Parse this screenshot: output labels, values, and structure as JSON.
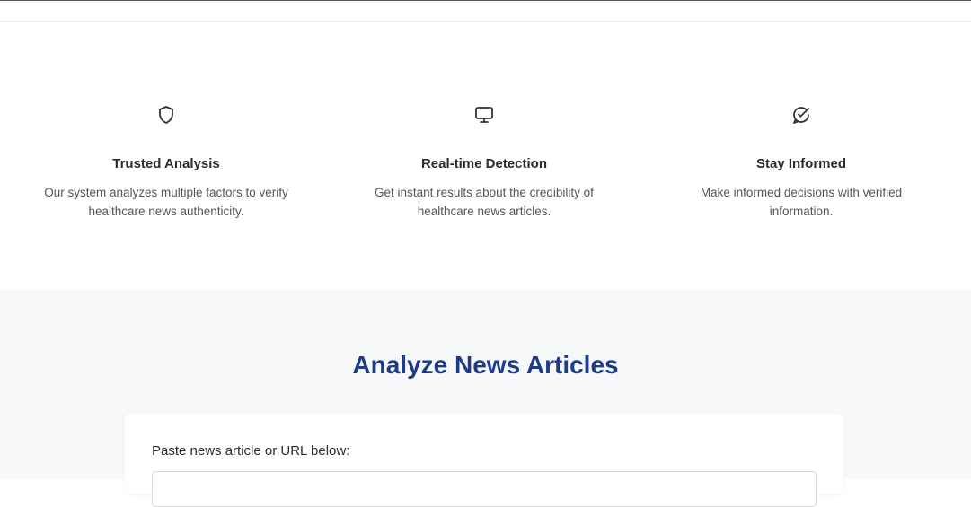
{
  "features": [
    {
      "icon": "shield-icon",
      "title": "Trusted Analysis",
      "description": "Our system analyzes multiple factors to verify healthcare news authenticity."
    },
    {
      "icon": "monitor-icon",
      "title": "Real-time Detection",
      "description": "Get instant results about the credibility of healthcare news articles."
    },
    {
      "icon": "message-check-icon",
      "title": "Stay Informed",
      "description": "Make informed decisions with verified information."
    }
  ],
  "analyze": {
    "title": "Analyze News Articles",
    "input_label": "Paste news article or URL below:",
    "input_value": ""
  },
  "colors": {
    "heading_blue": "#1e3a8a",
    "section_bg": "#f7f8fa"
  }
}
